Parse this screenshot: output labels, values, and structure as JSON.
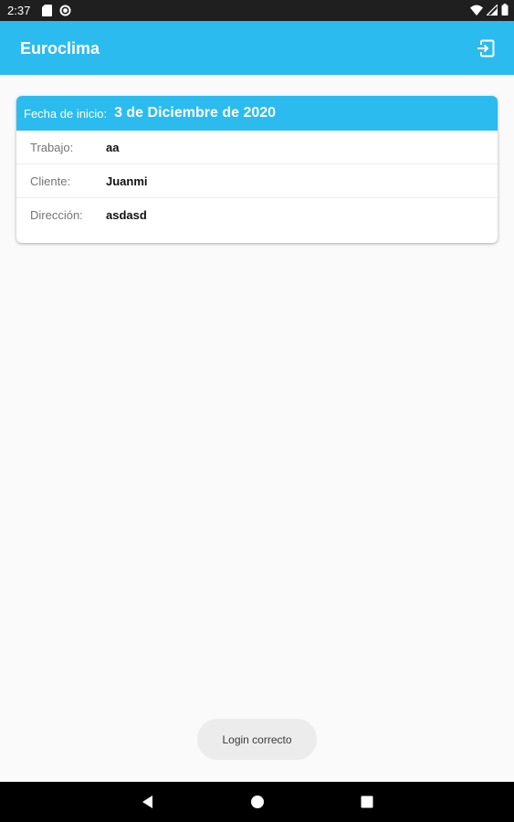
{
  "status_bar": {
    "time": "2:37",
    "left_icons": [
      "sd-card-icon",
      "at-sign-icon"
    ],
    "right_icons": [
      "wifi-icon",
      "cell-signal-icon",
      "battery-icon"
    ]
  },
  "app_bar": {
    "title": "Euroclima",
    "action_icon": "logout-icon"
  },
  "card": {
    "header_label": "Fecha de inicio:",
    "header_value": "3 de Diciembre de 2020",
    "rows": [
      {
        "label": "Trabajo:",
        "value": "aa"
      },
      {
        "label": "Cliente:",
        "value": "Juanmi"
      },
      {
        "label": "Dirección:",
        "value": "asdasd"
      }
    ]
  },
  "toast": {
    "text": "Login correcto"
  },
  "nav_bar": {
    "icons": [
      "back-icon",
      "home-icon",
      "recents-icon"
    ]
  },
  "colors": {
    "accent": "#2bbbef",
    "background": "#fafafa",
    "status_bar": "#1f1f1f",
    "nav_bar": "#000000"
  }
}
